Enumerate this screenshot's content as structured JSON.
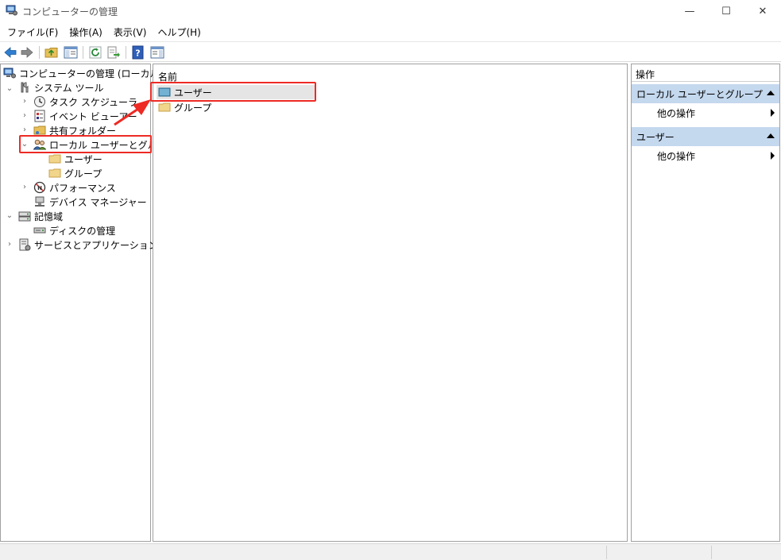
{
  "window": {
    "title": "コンピューターの管理",
    "minimize_glyph": "—",
    "maximize_glyph": "☐",
    "close_glyph": "✕"
  },
  "menu": {
    "items": [
      "ファイル(F)",
      "操作(A)",
      "表示(V)",
      "ヘルプ(H)"
    ]
  },
  "toolbar": {
    "icons": [
      "back-arrow-icon",
      "forward-arrow-icon",
      "up-folder-icon",
      "show-hide-console-tree-icon",
      "refresh-icon",
      "export-list-icon",
      "help-icon",
      "show-hide-action-pane-icon"
    ]
  },
  "tree": {
    "root": "コンピューターの管理 (ローカル)",
    "system_tools": "システム ツール",
    "task_scheduler": "タスク スケジューラ",
    "event_viewer": "イベント ビューアー",
    "shared_folders": "共有フォルダー",
    "local_users_groups": "ローカル ユーザーとグループ",
    "users": "ユーザー",
    "groups": "グループ",
    "performance": "パフォーマンス",
    "device_manager": "デバイス マネージャー",
    "storage": "記憶域",
    "disk_management": "ディスクの管理",
    "services_apps": "サービスとアプリケーション"
  },
  "list": {
    "column_name": "名前",
    "rows": [
      "ユーザー",
      "グループ"
    ]
  },
  "actions": {
    "title": "操作",
    "section1": "ローカル ユーザーとグループ",
    "section1_item": "他の操作",
    "section2": "ユーザー",
    "section2_item": "他の操作"
  },
  "colors": {
    "highlight_red": "#ee2a24",
    "section_blue": "#c4d8ee",
    "selection_gray": "#e5e5e5"
  }
}
